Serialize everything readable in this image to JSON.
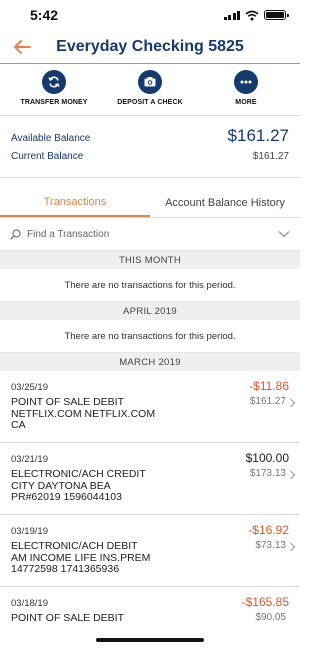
{
  "status_bar": {
    "time": "5:42"
  },
  "header": {
    "title": "Everyday Checking 5825"
  },
  "actions": [
    {
      "label": "TRANSFER MONEY",
      "icon": "transfer-icon"
    },
    {
      "label": "DEPOSIT A CHECK",
      "icon": "camera-icon"
    },
    {
      "label": "MORE",
      "icon": "more-icon"
    }
  ],
  "balances": {
    "available_label": "Available Balance",
    "available_value": "$161.27",
    "current_label": "Current Balance",
    "current_value": "$161.27"
  },
  "tabs": [
    {
      "label": "Transactions",
      "active": true
    },
    {
      "label": "Account Balance History",
      "active": false
    }
  ],
  "search": {
    "placeholder": "Find a Transaction"
  },
  "sections": {
    "this_month": "THIS MONTH",
    "this_month_empty": "There are no transactions for this period.",
    "april": "APRIL 2019",
    "april_empty": "There are no transactions for this period.",
    "march": "MARCH 2019"
  },
  "transactions": [
    {
      "date": "03/25/19",
      "description": "POINT OF SALE DEBIT\nNETFLIX.COM NETFLIX.COM\nCA",
      "amount": "-$11.86",
      "balance": "$161.27"
    },
    {
      "date": "03/21/19",
      "description": "ELECTRONIC/ACH CREDIT\nCITY DAYTONA BEA\nPR#62019 1596044103",
      "amount": "$100.00",
      "balance": "$173.13"
    },
    {
      "date": "03/19/19",
      "description": "ELECTRONIC/ACH DEBIT\nAM INCOME LIFE INS.PREM\n14772598 1741365936",
      "amount": "-$16.92",
      "balance": "$73.13"
    },
    {
      "date": "03/18/19",
      "description": "POINT OF SALE DEBIT",
      "amount": "-$165.85",
      "balance": "$90.05"
    }
  ],
  "colors": {
    "navy": "#163a6d",
    "orange": "#e8804a",
    "negative": "#d8572a"
  }
}
